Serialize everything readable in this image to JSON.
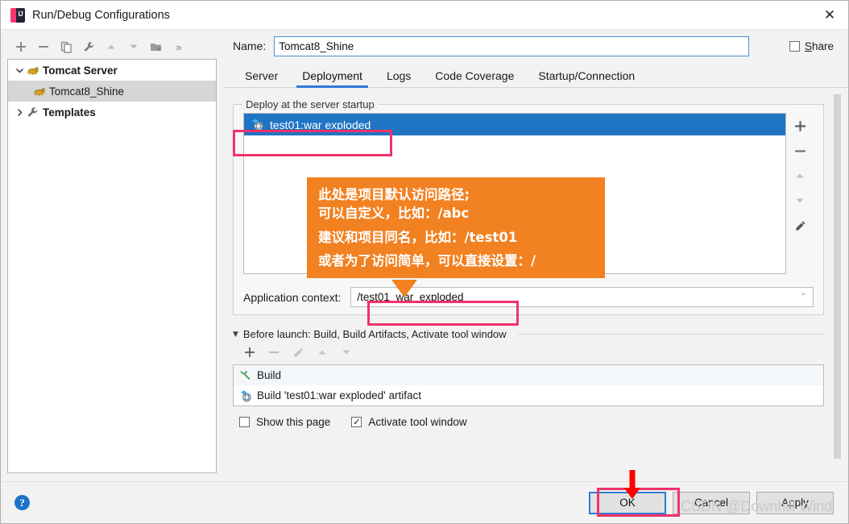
{
  "window": {
    "title": "Run/Debug Configurations",
    "app_icon": "intellij-idea-icon",
    "close_icon": "close-icon"
  },
  "left_toolbar": {
    "buttons": [
      {
        "name": "add-configuration-button",
        "icon": "plus-icon",
        "glyph": "+"
      },
      {
        "name": "remove-configuration-button",
        "icon": "minus-icon",
        "glyph": "−"
      },
      {
        "name": "copy-configuration-button",
        "icon": "copy-icon",
        "glyph": "❐"
      },
      {
        "name": "edit-templates-button",
        "icon": "wrench-icon",
        "glyph": "🔧"
      },
      {
        "name": "move-up-button",
        "icon": "arrow-up-icon",
        "glyph": "▲"
      },
      {
        "name": "move-down-button",
        "icon": "arrow-down-icon",
        "glyph": "▼"
      },
      {
        "name": "new-folder-button",
        "icon": "folder-add-icon",
        "glyph": "📁"
      },
      {
        "name": "more-options-button",
        "icon": "chevron-double-right-icon",
        "glyph": "»"
      }
    ]
  },
  "tree": {
    "nodes": [
      {
        "label": "Tomcat Server",
        "icon": "tomcat-icon",
        "expander": "chevron-down-icon",
        "bold": true,
        "selected": false,
        "indent": 0
      },
      {
        "label": "Tomcat8_Shine",
        "icon": "tomcat-icon",
        "expander": "",
        "bold": false,
        "selected": true,
        "indent": 1
      },
      {
        "label": "Templates",
        "icon": "wrench-icon",
        "expander": "chevron-right-icon",
        "bold": true,
        "selected": false,
        "indent": 0
      }
    ]
  },
  "name_row": {
    "label": "Name:",
    "value": "Tomcat8_Shine",
    "placeholder": "",
    "share": {
      "label_prefix": "",
      "label_mnemonic": "S",
      "label_rest": "hare",
      "checked": false
    }
  },
  "tabs": [
    {
      "label": "Server",
      "active": false
    },
    {
      "label": "Deployment",
      "active": true
    },
    {
      "label": "Logs",
      "active": false
    },
    {
      "label": "Code Coverage",
      "active": false
    },
    {
      "label": "Startup/Connection",
      "active": false
    }
  ],
  "deploy": {
    "group_title": "Deploy at the server startup",
    "items": [
      {
        "label": "test01:war exploded",
        "icon": "artifact-icon",
        "selected": true
      }
    ],
    "side_buttons": [
      {
        "name": "add-artifact-button",
        "icon": "plus-icon",
        "glyph": "+"
      },
      {
        "name": "remove-artifact-button",
        "icon": "minus-icon",
        "glyph": "−"
      },
      {
        "name": "move-artifact-up-button",
        "icon": "arrow-up-icon",
        "glyph": "▲"
      },
      {
        "name": "move-artifact-down-button",
        "icon": "arrow-down-icon",
        "glyph": "▼"
      },
      {
        "name": "edit-artifact-button",
        "icon": "pencil-icon",
        "glyph": "✎"
      }
    ],
    "context": {
      "label": "Application context:",
      "value": "/test01_war_exploded",
      "dropdown_icon": "chevron-down-icon"
    }
  },
  "before_launch": {
    "header": "Before launch: Build, Build Artifacts, Activate tool window",
    "collapse_icon": "triangle-down-icon",
    "toolbar": [
      {
        "name": "add-task-button",
        "icon": "plus-icon",
        "glyph": "+"
      },
      {
        "name": "remove-task-button",
        "icon": "minus-icon",
        "glyph": "−"
      },
      {
        "name": "edit-task-button",
        "icon": "pencil-icon",
        "glyph": "✎"
      },
      {
        "name": "move-task-up-button",
        "icon": "arrow-up-icon",
        "glyph": "▲"
      },
      {
        "name": "move-task-down-button",
        "icon": "arrow-down-icon",
        "glyph": "▼"
      }
    ],
    "tasks": [
      {
        "label": "Build",
        "icon": "hammer-icon"
      },
      {
        "label": "Build 'test01:war exploded' artifact",
        "icon": "artifact-icon"
      }
    ],
    "options": [
      {
        "label": "Show this page",
        "checked": false,
        "name": "show-this-page-checkbox"
      },
      {
        "label": "Activate tool window",
        "checked": true,
        "name": "activate-tool-window-checkbox"
      }
    ]
  },
  "footer": {
    "help_icon": "help-icon",
    "help_glyph": "?",
    "buttons": [
      {
        "label": "OK",
        "name": "ok-button",
        "primary": true
      },
      {
        "label": "Cancel",
        "name": "cancel-button",
        "primary": false
      },
      {
        "label": "Apply",
        "name": "apply-button",
        "primary": false
      }
    ]
  },
  "annotations": {
    "callout_lines": [
      "此处是项目默认访问路径;",
      "可以自定义，比如：/abc",
      "建议和项目同名，比如：/test01",
      "或者为了访问简单，可以直接设置：/"
    ],
    "callout_color": "#f28121",
    "highlight_color": "#f1326a",
    "watermark": "CSDN @Downhill Wind"
  }
}
